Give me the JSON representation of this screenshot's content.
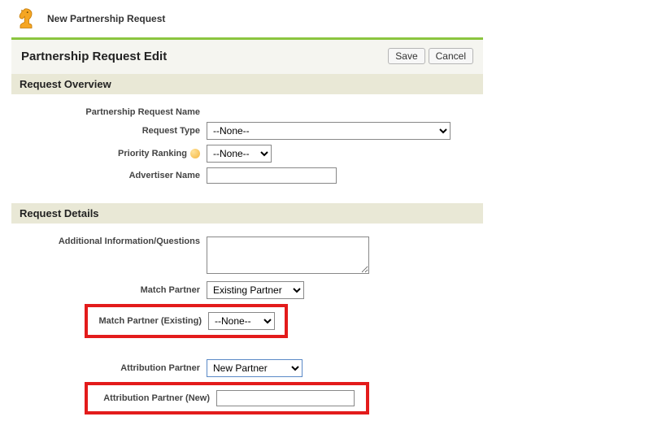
{
  "header": {
    "title": "New Partnership Request"
  },
  "form": {
    "title": "Partnership Request Edit",
    "buttons": {
      "save": "Save",
      "cancel": "Cancel"
    }
  },
  "overview": {
    "section_title": "Request Overview",
    "labels": {
      "name": "Partnership Request Name",
      "type": "Request Type",
      "priority": "Priority Ranking",
      "advertiser": "Advertiser Name"
    },
    "type_value": "--None--",
    "priority_value": "--None--",
    "advertiser_value": ""
  },
  "details": {
    "section_title": "Request Details",
    "labels": {
      "additional": "Additional Information/Questions",
      "match_partner": "Match Partner",
      "match_existing": "Match Partner (Existing)",
      "attribution_partner": "Attribution Partner",
      "attribution_new": "Attribution Partner (New)"
    },
    "additional_value": "",
    "match_partner_value": "Existing Partner",
    "match_existing_value": "--None--",
    "attribution_partner_value": "New Partner",
    "attribution_new_value": ""
  }
}
